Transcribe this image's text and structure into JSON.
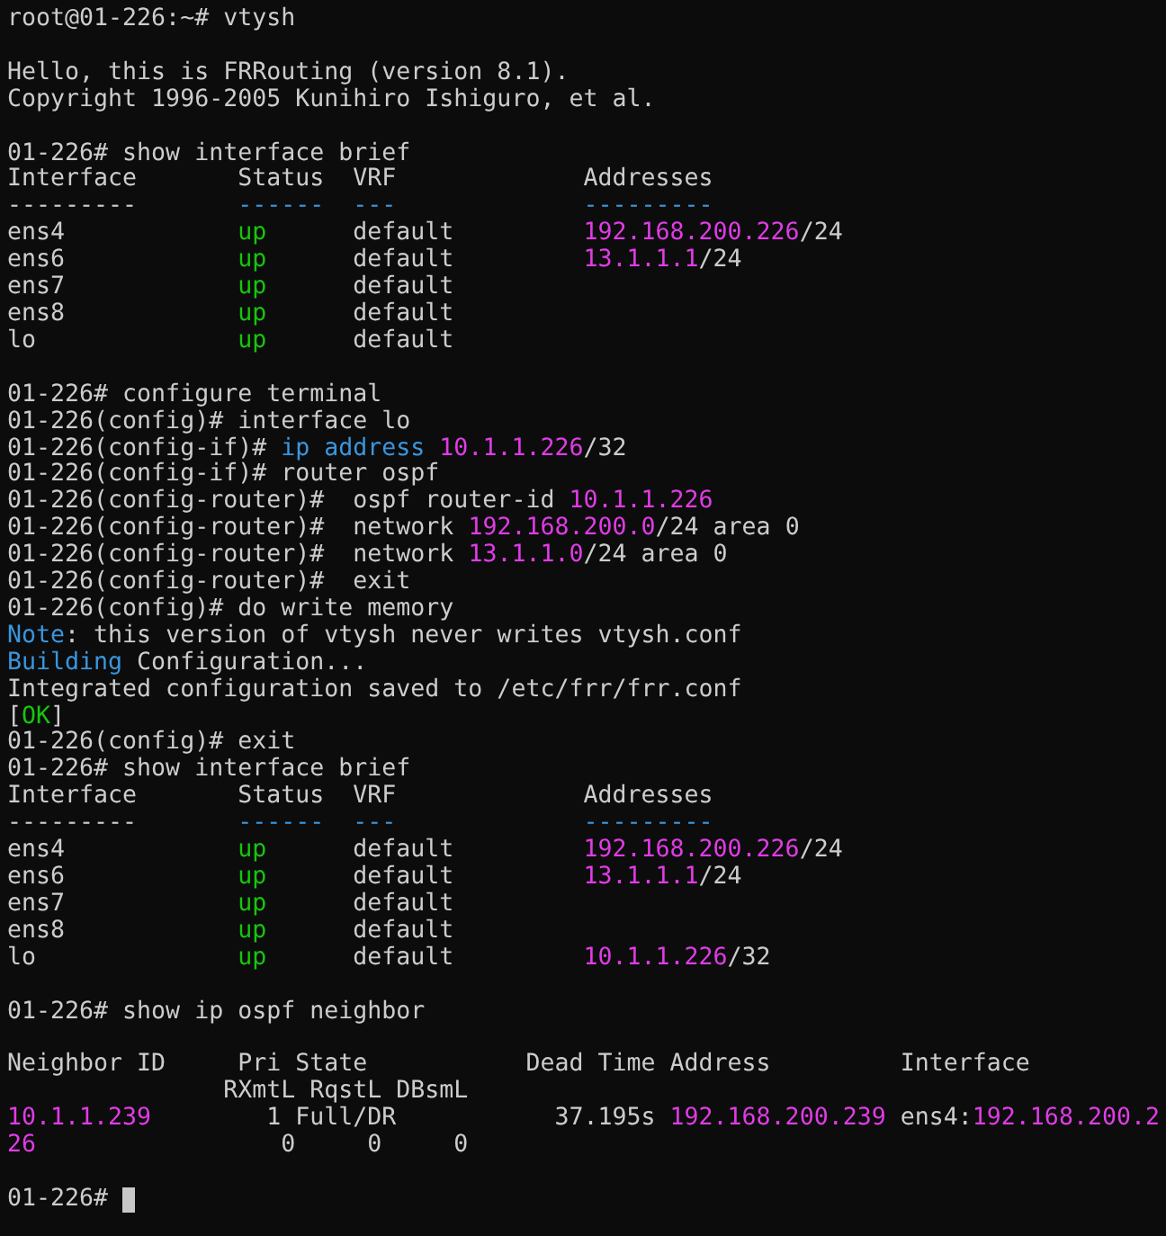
{
  "terminal": {
    "lines": [
      {
        "kind": "text",
        "segments": [
          {
            "text": "root@01-226:~# vtysh"
          }
        ]
      },
      {
        "kind": "blank"
      },
      {
        "kind": "text",
        "segments": [
          {
            "text": "Hello, this is FRRouting (version 8.1)."
          }
        ]
      },
      {
        "kind": "text",
        "segments": [
          {
            "text": "Copyright 1996-2005 Kunihiro Ishiguro, et al."
          }
        ]
      },
      {
        "kind": "blank"
      },
      {
        "kind": "text",
        "segments": [
          {
            "text": "01-226# show interface brief"
          }
        ]
      },
      {
        "kind": "text",
        "segments": [
          {
            "text": "Interface       Status  VRF             Addresses"
          }
        ]
      },
      {
        "kind": "text",
        "segments": [
          {
            "text": "---------       "
          },
          {
            "text": "------  ",
            "color": "#3a96dd"
          },
          {
            "text": "---             ",
            "color": "#3a96dd"
          },
          {
            "text": "---------",
            "color": "#3a96dd"
          }
        ]
      },
      {
        "kind": "text",
        "segments": [
          {
            "text": "ens4            "
          },
          {
            "text": "up",
            "color": "#16c60c"
          },
          {
            "text": "      default         "
          },
          {
            "text": "192.168.200.226",
            "color": "#e03ce6"
          },
          {
            "text": "/24"
          }
        ]
      },
      {
        "kind": "text",
        "segments": [
          {
            "text": "ens6            "
          },
          {
            "text": "up",
            "color": "#16c60c"
          },
          {
            "text": "      default         "
          },
          {
            "text": "13.1.1.1",
            "color": "#e03ce6"
          },
          {
            "text": "/24"
          }
        ]
      },
      {
        "kind": "text",
        "segments": [
          {
            "text": "ens7            "
          },
          {
            "text": "up",
            "color": "#16c60c"
          },
          {
            "text": "      default"
          }
        ]
      },
      {
        "kind": "text",
        "segments": [
          {
            "text": "ens8            "
          },
          {
            "text": "up",
            "color": "#16c60c"
          },
          {
            "text": "      default"
          }
        ]
      },
      {
        "kind": "text",
        "segments": [
          {
            "text": "lo              "
          },
          {
            "text": "up",
            "color": "#16c60c"
          },
          {
            "text": "      default"
          }
        ]
      },
      {
        "kind": "blank"
      },
      {
        "kind": "text",
        "segments": [
          {
            "text": "01-226# configure terminal"
          }
        ]
      },
      {
        "kind": "text",
        "segments": [
          {
            "text": "01-226(config)# interface lo"
          }
        ]
      },
      {
        "kind": "text",
        "segments": [
          {
            "text": "01-226(config-if)# "
          },
          {
            "text": "ip address ",
            "color": "#3a96dd"
          },
          {
            "text": "10.1.1.226",
            "color": "#e03ce6"
          },
          {
            "text": "/32"
          }
        ]
      },
      {
        "kind": "text",
        "segments": [
          {
            "text": "01-226(config-if)# router ospf"
          }
        ]
      },
      {
        "kind": "text",
        "segments": [
          {
            "text": "01-226(config-router)#  ospf router-id "
          },
          {
            "text": "10.1.1.226",
            "color": "#e03ce6"
          }
        ]
      },
      {
        "kind": "text",
        "segments": [
          {
            "text": "01-226(config-router)#  network "
          },
          {
            "text": "192.168.200.0",
            "color": "#e03ce6"
          },
          {
            "text": "/24 area 0"
          }
        ]
      },
      {
        "kind": "text",
        "segments": [
          {
            "text": "01-226(config-router)#  network "
          },
          {
            "text": "13.1.1.0",
            "color": "#e03ce6"
          },
          {
            "text": "/24 area 0"
          }
        ]
      },
      {
        "kind": "text",
        "segments": [
          {
            "text": "01-226(config-router)#  exit"
          }
        ]
      },
      {
        "kind": "text",
        "segments": [
          {
            "text": "01-226(config)# do write memory"
          }
        ]
      },
      {
        "kind": "text",
        "segments": [
          {
            "text": "Note",
            "color": "#3a96dd"
          },
          {
            "text": ": this version of vtysh never writes vtysh.conf"
          }
        ]
      },
      {
        "kind": "text",
        "segments": [
          {
            "text": "Building",
            "color": "#3a96dd"
          },
          {
            "text": " Configuration..."
          }
        ]
      },
      {
        "kind": "text",
        "segments": [
          {
            "text": "Integrated configuration saved to /etc/frr/frr.conf"
          }
        ]
      },
      {
        "kind": "text",
        "segments": [
          {
            "text": "["
          },
          {
            "text": "OK",
            "color": "#16c60c"
          },
          {
            "text": "]"
          }
        ]
      },
      {
        "kind": "text",
        "segments": [
          {
            "text": "01-226(config)# exit"
          }
        ]
      },
      {
        "kind": "text",
        "segments": [
          {
            "text": "01-226# show interface brief"
          }
        ]
      },
      {
        "kind": "text",
        "segments": [
          {
            "text": "Interface       Status  VRF             Addresses"
          }
        ]
      },
      {
        "kind": "text",
        "segments": [
          {
            "text": "---------       "
          },
          {
            "text": "------  ",
            "color": "#3a96dd"
          },
          {
            "text": "---             ",
            "color": "#3a96dd"
          },
          {
            "text": "---------",
            "color": "#3a96dd"
          }
        ]
      },
      {
        "kind": "text",
        "segments": [
          {
            "text": "ens4            "
          },
          {
            "text": "up",
            "color": "#16c60c"
          },
          {
            "text": "      default         "
          },
          {
            "text": "192.168.200.226",
            "color": "#e03ce6"
          },
          {
            "text": "/24"
          }
        ]
      },
      {
        "kind": "text",
        "segments": [
          {
            "text": "ens6            "
          },
          {
            "text": "up",
            "color": "#16c60c"
          },
          {
            "text": "      default         "
          },
          {
            "text": "13.1.1.1",
            "color": "#e03ce6"
          },
          {
            "text": "/24"
          }
        ]
      },
      {
        "kind": "text",
        "segments": [
          {
            "text": "ens7            "
          },
          {
            "text": "up",
            "color": "#16c60c"
          },
          {
            "text": "      default"
          }
        ]
      },
      {
        "kind": "text",
        "segments": [
          {
            "text": "ens8            "
          },
          {
            "text": "up",
            "color": "#16c60c"
          },
          {
            "text": "      default"
          }
        ]
      },
      {
        "kind": "text",
        "segments": [
          {
            "text": "lo              "
          },
          {
            "text": "up",
            "color": "#16c60c"
          },
          {
            "text": "      default         "
          },
          {
            "text": "10.1.1.226",
            "color": "#e03ce6"
          },
          {
            "text": "/32"
          }
        ]
      },
      {
        "kind": "blank"
      },
      {
        "kind": "text",
        "segments": [
          {
            "text": "01-226# show ip ospf neighbor"
          }
        ]
      },
      {
        "kind": "blank"
      },
      {
        "kind": "text",
        "segments": [
          {
            "text": "Neighbor ID     Pri State           Dead Time Address         Interface"
          }
        ]
      },
      {
        "kind": "text",
        "segments": [
          {
            "text": "               RXmtL RqstL DBsmL"
          }
        ]
      },
      {
        "kind": "text",
        "segments": [
          {
            "text": "10.1.1.239",
            "color": "#e03ce6"
          },
          {
            "text": "        1 Full/DR           37.195s "
          },
          {
            "text": "192.168.200.239",
            "color": "#e03ce6"
          },
          {
            "text": " ens4:"
          },
          {
            "text": "192.168.200.2",
            "color": "#e03ce6"
          }
        ]
      },
      {
        "kind": "text",
        "segments": [
          {
            "text": "26",
            "color": "#e03ce6"
          },
          {
            "text": "                 0     0     0"
          }
        ]
      },
      {
        "kind": "blank"
      },
      {
        "kind": "text",
        "segments": [
          {
            "text": "01-226# "
          }
        ],
        "cursor": true
      }
    ]
  }
}
